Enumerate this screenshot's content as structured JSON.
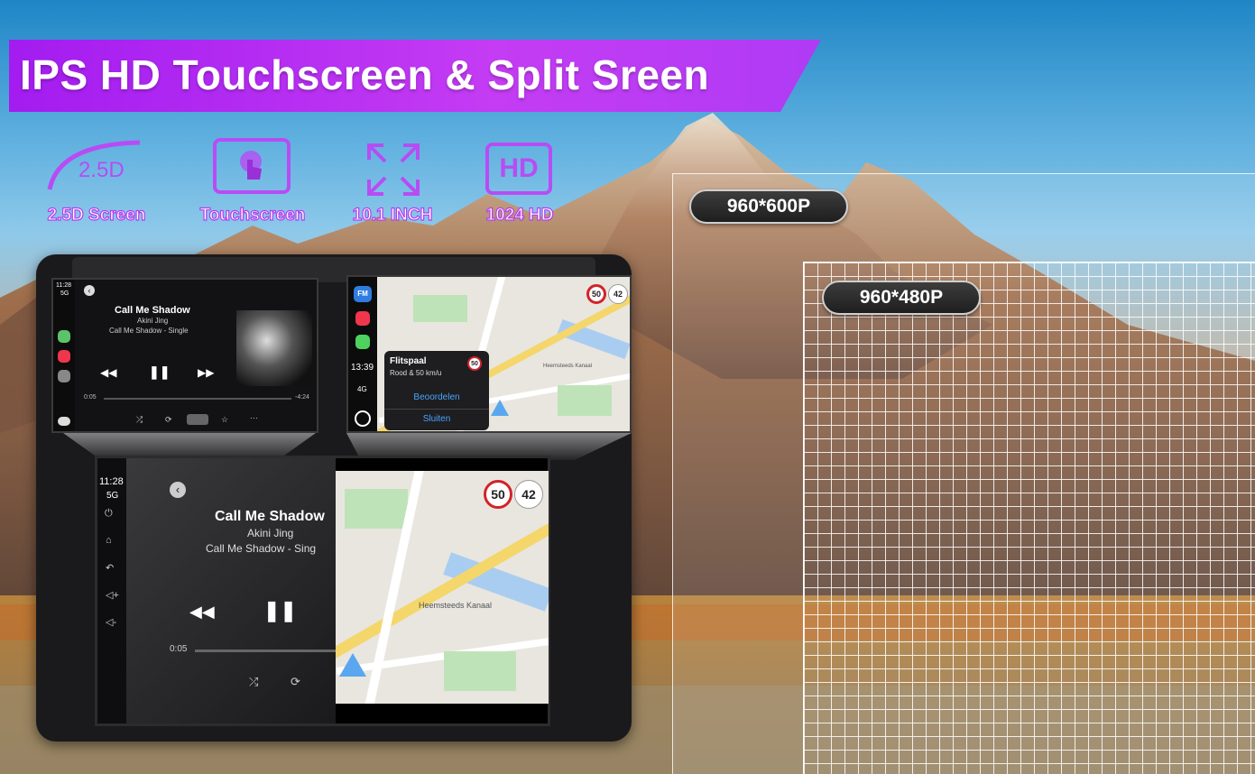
{
  "banner": {
    "title": "IPS HD Touchscreen & Split Sreen"
  },
  "features": [
    {
      "label": "2.5D Screen",
      "icon": "curve-2-5d-icon",
      "icon_text": "2.5D"
    },
    {
      "label": "Touchscreen",
      "icon": "touch-hand-icon"
    },
    {
      "label": "10.1 INCH",
      "icon": "expand-arrows-icon"
    },
    {
      "label": "1024 HD",
      "icon": "hd-box-icon",
      "icon_text": "HD"
    }
  ],
  "resolutions": {
    "large": "960*600P",
    "small": "960*480P"
  },
  "top_left_screen": {
    "time": "11:28",
    "network": "5G",
    "song": "Call Me Shadow",
    "artist": "Akini Jing",
    "album": "Call Me Shadow - Single",
    "elapsed": "0:05",
    "remaining": "-4:24"
  },
  "top_right_screen": {
    "time": "13:39",
    "network": "4G",
    "fm_label": "FM",
    "speed_sign": "50",
    "speed_current": "42",
    "alert_title": "Flitspaal",
    "alert_sub": "Rood & 50 km/u",
    "alert_badge": "50",
    "rate_button": "Beoordelen",
    "close_button": "Sluiten",
    "street": "Heemsteeds Kanaal"
  },
  "main_screen": {
    "time": "11:28",
    "network": "5G",
    "song": "Call Me Shadow",
    "artist": "Akini Jing",
    "album": "Call Me Shadow - Sing",
    "elapsed": "0:05",
    "speed_sign": "50",
    "speed_current": "42",
    "street": "Heemsteeds Kanaal"
  },
  "colors": {
    "accent": "#b43cf0",
    "banner": "#b52df2",
    "nav": "#3f8ee8"
  }
}
